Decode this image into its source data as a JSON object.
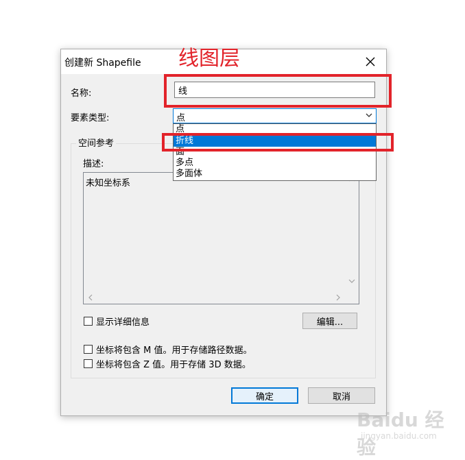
{
  "annotation": {
    "title": "线图层"
  },
  "dialog": {
    "title": "创建新 Shapefile",
    "name_label": "名称:",
    "name_value": "线",
    "feature_type_label": "要素类型:",
    "feature_type_value": "点",
    "feature_type_options": [
      "点",
      "折线",
      "面",
      "多点",
      "多面体"
    ],
    "selected_option_index": 1,
    "spatial_ref_group": "空间参考",
    "description_label": "描述:",
    "description_value": "未知坐标系",
    "show_details_label": "显示详细信息",
    "edit_button": "编辑...",
    "m_values_label": "坐标将包含 M 值。用于存储路径数据。",
    "z_values_label": "坐标将包含 Z 值。用于存储 3D 数据。",
    "ok_button": "确定",
    "cancel_button": "取消"
  },
  "watermark": {
    "brand": "Baidu 经验",
    "url": "jingyan.baidu.com"
  },
  "colors": {
    "annotation_red": "#e2232a",
    "selection_blue": "#0078d7"
  }
}
